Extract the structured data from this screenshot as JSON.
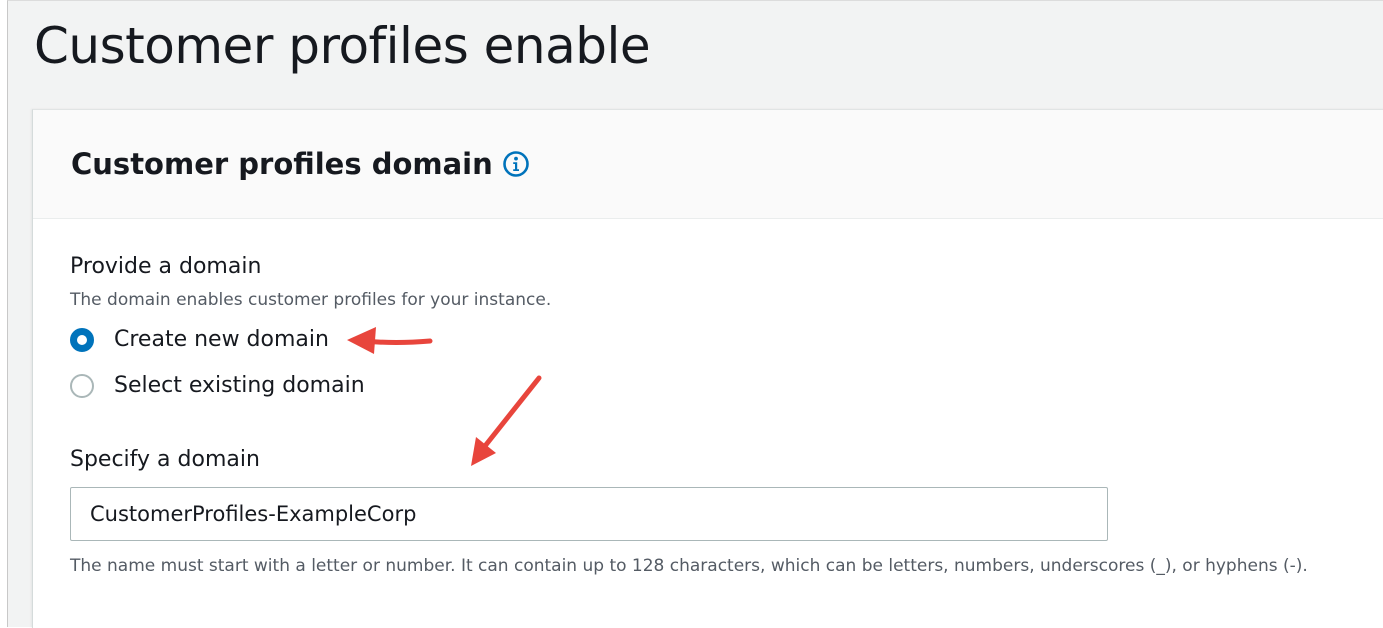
{
  "page": {
    "title": "Customer profiles enable"
  },
  "panel": {
    "title": "Customer profiles domain",
    "info_icon": "info-circle-icon"
  },
  "provide_domain": {
    "label": "Provide a domain",
    "description": "The domain enables customer profiles for your instance.",
    "options": [
      {
        "label": "Create new domain",
        "checked": true
      },
      {
        "label": "Select existing domain",
        "checked": false
      }
    ]
  },
  "specify_domain": {
    "label": "Specify a domain",
    "value": "CustomerProfiles-ExampleCorp",
    "hint": "The name must start with a letter or number. It can contain up to 128 characters, which can be letters, numbers, underscores (_), or hyphens (-)."
  },
  "colors": {
    "accent": "#0073bb",
    "annotation_arrow": "#e8453c",
    "text": "#16191f",
    "secondary_text": "#545b64"
  },
  "annotations": [
    {
      "name": "arrow-to-create-new-domain",
      "icon": "red-arrow-icon"
    },
    {
      "name": "arrow-to-domain-input",
      "icon": "red-arrow-icon"
    }
  ]
}
